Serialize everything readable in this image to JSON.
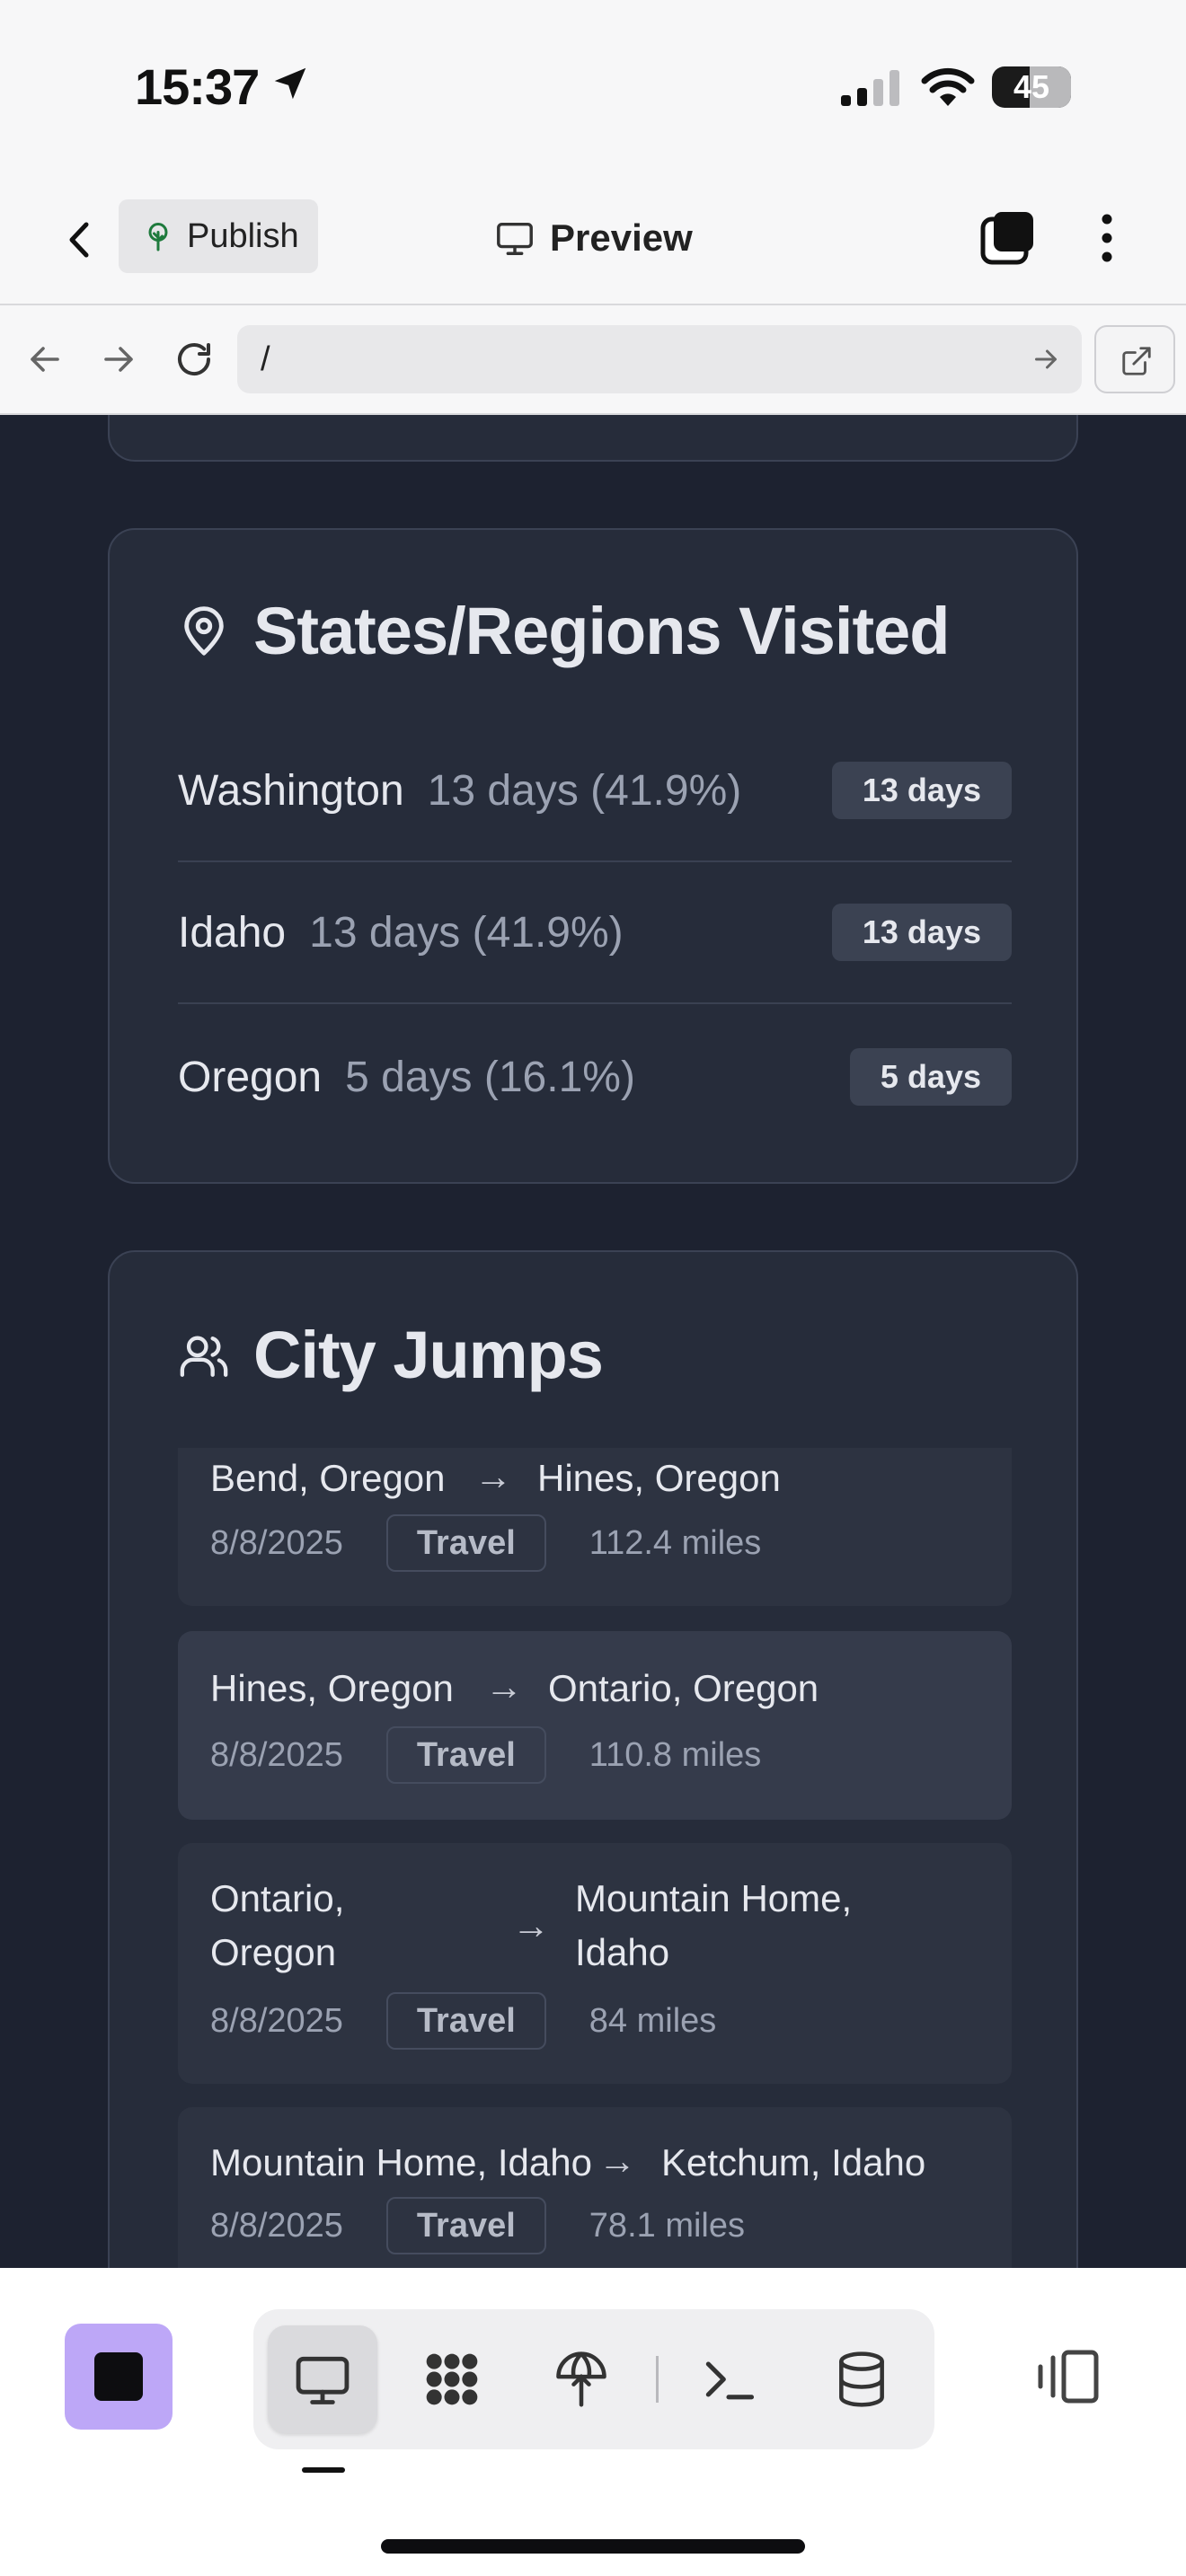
{
  "status_bar": {
    "time": "15:37",
    "battery": "45"
  },
  "header": {
    "publish_label": "Publish",
    "preview_label": "Preview"
  },
  "browser": {
    "url": "/"
  },
  "states_card": {
    "title": "States/Regions Visited",
    "rows": [
      {
        "name": "Washington",
        "detail": "13 days (41.9%)",
        "badge": "13 days"
      },
      {
        "name": "Idaho",
        "detail": "13 days (41.9%)",
        "badge": "13 days"
      },
      {
        "name": "Oregon",
        "detail": "5 days (16.1%)",
        "badge": "5 days"
      }
    ]
  },
  "jumps_card": {
    "title": "City Jumps",
    "items": [
      {
        "from": "Bend, Oregon",
        "to": "Hines, Oregon",
        "date": "8/8/2025",
        "tag": "Travel",
        "distance": "112.4 miles"
      },
      {
        "from": "Hines, Oregon",
        "to": "Ontario, Oregon",
        "date": "8/8/2025",
        "tag": "Travel",
        "distance": "110.8 miles"
      },
      {
        "from_line1": "Ontario,",
        "from_line2": "Oregon",
        "to_line1": "Mountain Home,",
        "to_line2": "Idaho",
        "date": "8/8/2025",
        "tag": "Travel",
        "distance": "84 miles"
      },
      {
        "from": "Mountain Home, Idaho",
        "to": "Ketchum, Idaho",
        "date": "8/8/2025",
        "tag": "Travel",
        "distance": "78.1 miles"
      }
    ],
    "arrow_glyph": "→"
  },
  "colors": {
    "content_bg": "#1d2230",
    "card_bg": "#262c3a",
    "accent_app_icon": "#bda7f7"
  },
  "icons": {
    "status": [
      "location-arrow-icon",
      "signal-icon",
      "wifi-icon",
      "battery-icon"
    ],
    "header": [
      "back-chevron-icon",
      "tree-icon",
      "monitor-icon",
      "tabs-icon",
      "more-vertical-icon"
    ],
    "browser": [
      "back-arrow-icon",
      "forward-arrow-icon",
      "reload-icon",
      "go-arrow-icon",
      "external-link-icon"
    ],
    "cards": [
      "map-pin-icon",
      "users-icon"
    ],
    "toolbar": [
      "desktop-icon",
      "dots-grid-icon",
      "deploy-icon",
      "terminal-icon",
      "database-icon",
      "sidebar-toggle-icon"
    ]
  }
}
